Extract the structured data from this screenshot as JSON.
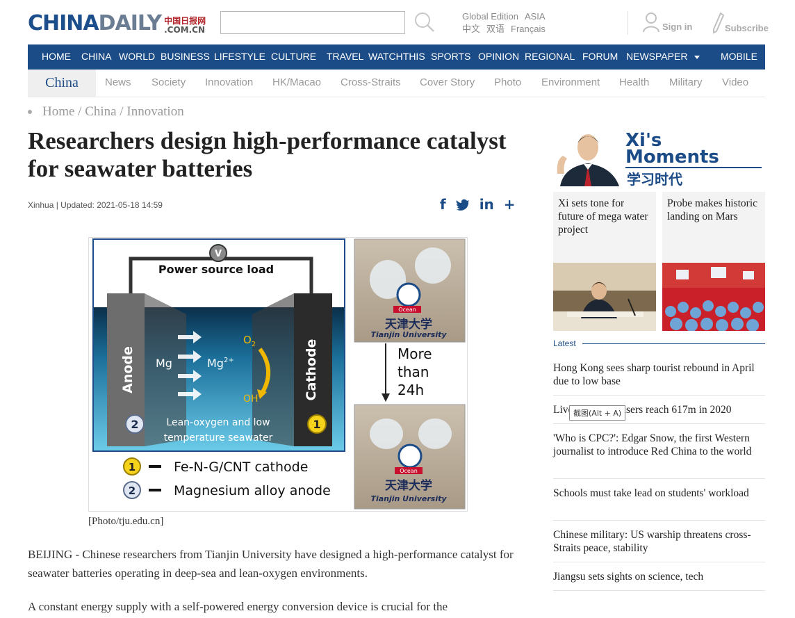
{
  "logo": {
    "part1": "CHINA",
    "part2": "DAILY",
    "cn": "中国日报网",
    "domain": ".COM.CN"
  },
  "search": {
    "placeholder": ""
  },
  "edition": {
    "global": "Global Edition",
    "asia": "ASIA",
    "zh": "中文",
    "bilingual": "双语",
    "fr": "Français"
  },
  "account": {
    "signin": "Sign in",
    "subscribe": "Subscribe"
  },
  "mainnav": [
    "HOME",
    "CHINA",
    "WORLD",
    "BUSINESS",
    "LIFESTYLE",
    "CULTURE",
    "TRAVEL",
    "WATCHTHIS",
    "SPORTS",
    "OPINION",
    "REGIONAL",
    "FORUM",
    "NEWSPAPER",
    "MOBILE"
  ],
  "subnav": {
    "channel": "China",
    "items": [
      "News",
      "Society",
      "Innovation",
      "HK/Macao",
      "Cross-Straits",
      "Cover Story",
      "Photo",
      "Environment",
      "Health",
      "Military",
      "Video"
    ]
  },
  "breadcrumb": "Home / China / Innovation",
  "article": {
    "title": "Researchers design high-performance catalyst for seawater batteries",
    "meta": "Xinhua | Updated: 2021-05-18 14:59",
    "caption": "[Photo/tju.edu.cn]",
    "p1": "BEIJING - Chinese researchers from Tianjin University have designed a high-performance catalyst for seawater batteries operating in deep-sea and lean-oxygen environments.",
    "p2": "A constant energy supply with a self-powered energy conversion device is crucial for the"
  },
  "figure": {
    "power": "Power source load",
    "v": "V",
    "anode": "Anode",
    "cathode": "Cathode",
    "mg": "Mg",
    "mg2": "Mg",
    "mg2sup": "2+",
    "o2": "O",
    "o2sub": "2",
    "oh": "OH",
    "ohsup": "-",
    "lean1": "Lean-oxygen and low",
    "lean2": "temperature seawater",
    "n1": "1",
    "n2": "2",
    "legend1": "Fe-N-G/CNT cathode",
    "legend2": "Magnesium alloy anode",
    "more1": "More",
    "more2": "than",
    "more3": "24h",
    "tju_cn": "天津大学",
    "tju_en": "Tianjin University",
    "ocean": "Ocean"
  },
  "xi": {
    "title1": "Xi's",
    "title2": "Moments",
    "cn": "学习时代"
  },
  "cards": [
    {
      "text": "Xi sets tone for future of mega water project"
    },
    {
      "text": "Probe makes historic landing on Mars"
    }
  ],
  "latest": {
    "label": "Latest",
    "items": [
      "Hong Kong sees sharp tourist rebound in April due to low base",
      "Live streaming users reach 617m in 2020",
      "'Who is CPC?': Edgar Snow, the first Western journalist to introduce Red China to the world",
      "Schools must take lead on students' workload",
      "Chinese military: US warship threatens cross-Straits peace, stability",
      "Jiangsu sets sights on science, tech"
    ]
  },
  "tooltip": "截图(Alt + A)",
  "colors": {
    "brand": "#1c4c88",
    "logo_red": "#b2252b"
  }
}
